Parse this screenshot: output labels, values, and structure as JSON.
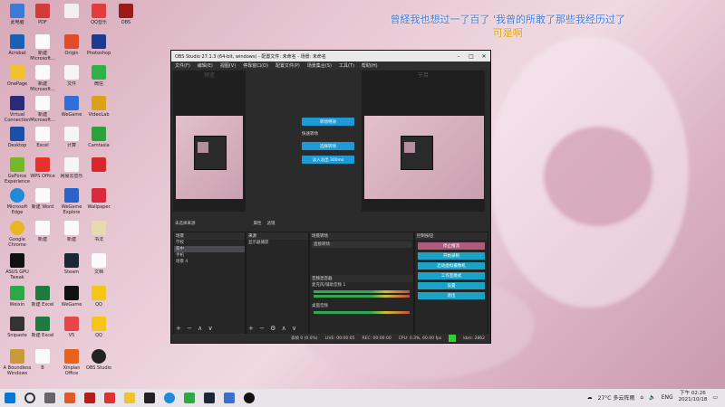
{
  "overlay": {
    "line1": "曾経我也想过一了百了 '我曾的所敢了那些我经历过了",
    "line2": "可是啊"
  },
  "desktop_icons": [
    {
      "label": "此电脑"
    },
    {
      "label": "PDF"
    },
    {
      "label": ""
    },
    {
      "label": "QQ音乐"
    },
    {
      "label": "OBS"
    },
    {
      "label": "Acrobat"
    },
    {
      "label": "新建 Microsoft..."
    },
    {
      "label": "Origin"
    },
    {
      "label": "Photoshop"
    },
    {
      "label": "OnePage"
    },
    {
      "label": "新建 Microsoft..."
    },
    {
      "label": "文件"
    },
    {
      "label": "微信"
    },
    {
      "label": "Virtual Connection"
    },
    {
      "label": "新建 Microsoft..."
    },
    {
      "label": "WeGame"
    },
    {
      "label": "VideoLab"
    },
    {
      "label": "Desktop"
    },
    {
      "label": "Excel"
    },
    {
      "label": "计算"
    },
    {
      "label": "Camtasia"
    },
    {
      "label": "GeForce Experience"
    },
    {
      "label": "WPS Office"
    },
    {
      "label": "网易云音乐"
    },
    {
      "label": ""
    },
    {
      "label": "Microsoft Edge"
    },
    {
      "label": "新建 Word"
    },
    {
      "label": "WeGame Explore"
    },
    {
      "label": "Wallpaper"
    },
    {
      "label": "Google Chrome"
    },
    {
      "label": "新建"
    },
    {
      "label": "新建"
    },
    {
      "label": "书法"
    },
    {
      "label": "ASUS GPU Tweak"
    },
    {
      "label": "Steam"
    },
    {
      "label": "文档"
    },
    {
      "label": ""
    },
    {
      "label": "Weixin"
    },
    {
      "label": "新建 Excel"
    },
    {
      "label": "WeGame"
    },
    {
      "label": "QQ"
    },
    {
      "label": "Snipaste"
    },
    {
      "label": "新建 Excel"
    },
    {
      "label": "V5"
    },
    {
      "label": "QQ"
    },
    {
      "label": "A Boundless Windows"
    },
    {
      "label": "B"
    },
    {
      "label": "Xinpian Office"
    },
    {
      "label": "OBS Studio"
    }
  ],
  "obs": {
    "title": "OBS Studio 27.1.3 (64-bit, windows) - 配置文件: 未命名 - 场景: 未命名",
    "menu": [
      "文件(F)",
      "编辑(E)",
      "视图(V)",
      "停靠窗口(D)",
      "配置文件(P)",
      "场景集合(S)",
      "工具(T)",
      "帮助(H)"
    ],
    "preview_label": "预览",
    "program_label": "节目",
    "mid_buttons": [
      "转场特效",
      "选择转场",
      "淡入淡出 300ms"
    ],
    "mid_text": "快速转场",
    "midbar_label": "未选择来源",
    "midbar_btns": [
      "属性",
      "滤镜"
    ],
    "docks": {
      "scenes_title": "场景",
      "scenes": [
        "学校",
        "家中",
        "手机",
        "场景 4"
      ],
      "sources_title": "来源",
      "sources": [
        "显示器捕获"
      ],
      "transitions_title": "场景转场",
      "transition_value": "直接转场",
      "audio_title": "音频混音器",
      "audio_channels": [
        "麦克风/辅助音频 1",
        "桌面音频"
      ],
      "controls_title": "控制按钮",
      "controls": [
        "停止推流",
        "开始录制",
        "启动虚拟摄像机",
        "工作室模式",
        "设置",
        "退出"
      ]
    },
    "status": [
      "丢帧 0 (0.0%)",
      "LIVE: 00:00:05",
      "REC: 00:00:00",
      "CPU: 0.3%, 60.00 fps",
      "kb/s: 2862"
    ]
  },
  "taskbar": {
    "weather": "27°C 多云阵雨",
    "lang": "ENG",
    "time": "下午 02:26",
    "date": "2021/10/18"
  }
}
